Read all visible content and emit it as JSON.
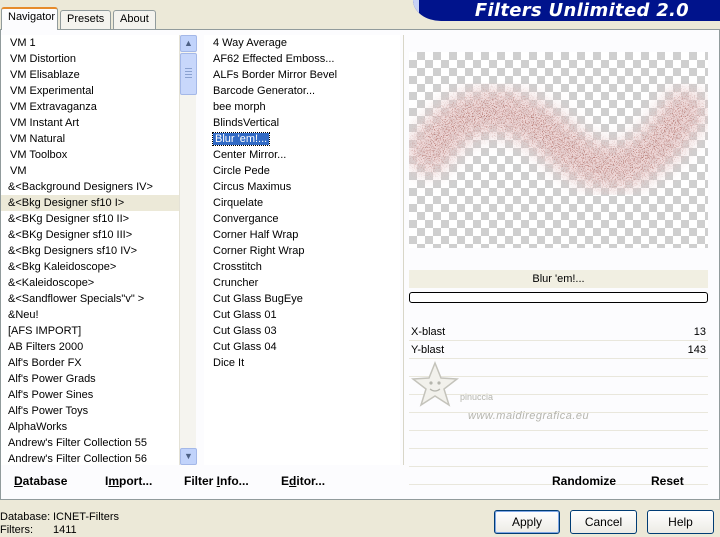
{
  "tabs": [
    "Navigator",
    "Presets",
    "About"
  ],
  "app_title": "Filters Unlimited 2.0",
  "categories": [
    "VM 1",
    "VM Distortion",
    "VM Elisablaze",
    "VM Experimental",
    "VM Extravaganza",
    "VM Instant Art",
    "VM Natural",
    "VM Toolbox",
    "VM",
    "&<Background Designers IV>",
    "&<Bkg Designer sf10 I>",
    "&<BKg Designer sf10 II>",
    "&<BKg Designer sf10 III>",
    "&<Bkg Designers sf10 IV>",
    "&<Bkg Kaleidoscope>",
    "&<Kaleidoscope>",
    "&<Sandflower Specials\"v\" >",
    "&Neu!",
    "[AFS IMPORT]",
    "AB Filters 2000",
    "Alf's Border FX",
    "Alf's Power Grads",
    "Alf's Power Sines",
    "Alf's Power Toys",
    "AlphaWorks",
    "Andrew's Filter Collection 55",
    "Andrew's Filter Collection 56"
  ],
  "filters": [
    "4 Way Average",
    "AF62 Effected Emboss...",
    "ALFs Border Mirror Bevel",
    "Barcode Generator...",
    "bee morph",
    "BlindsVertical",
    "Blur 'em!...",
    "Center Mirror...",
    "Circle Pede",
    "Circus Maximus",
    "Cirquelate",
    "Convergance",
    "Corner Half Wrap",
    "Corner Right Wrap",
    "Crosstitch",
    "Cruncher",
    "Cut Glass  BugEye",
    "Cut Glass 01",
    "Cut Glass 03",
    "Cut Glass 04",
    "Dice It"
  ],
  "selected_filter": "Blur 'em!...",
  "selected_category": "&<Bkg Designer sf10 I>",
  "preview": {
    "filter_name": "Blur 'em!..."
  },
  "params": [
    {
      "label": "X-blast",
      "value": "13"
    },
    {
      "label": "Y-blast",
      "value": "143"
    }
  ],
  "watermark": {
    "name": "pinuccia",
    "url": "www.maidiregrafica.eu"
  },
  "actions": {
    "database": {
      "u": "D",
      "rest": "atabase"
    },
    "import": {
      "pre": "I",
      "u": "m",
      "rest": "port..."
    },
    "filter_info": {
      "pre": "Filter ",
      "u": "I",
      "rest": "nfo..."
    },
    "editor": {
      "pre": "E",
      "u": "d",
      "rest": "itor..."
    },
    "randomize": "Randomize",
    "reset": "Reset"
  },
  "status": {
    "db_label": "Database:",
    "db_value": "ICNET-Filters",
    "filters_label": "Filters:",
    "filters_value": "1411"
  },
  "buttons": {
    "apply": "Apply",
    "cancel": "Cancel",
    "help": "Help"
  },
  "colors": {
    "banner": "#00138c",
    "selection": "#316ac5",
    "tab_accent": "#e68b2c"
  }
}
